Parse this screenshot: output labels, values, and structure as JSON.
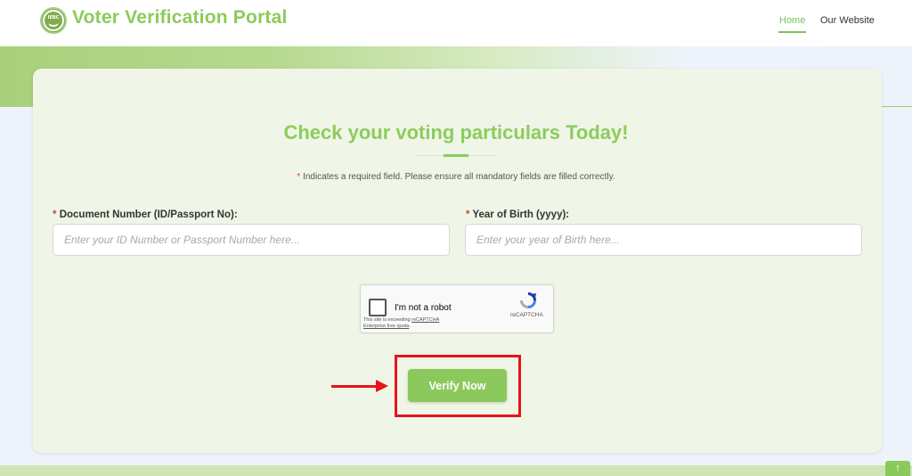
{
  "header": {
    "logo_icon": "emblem-icon",
    "title": "Voter Verification Portal",
    "nav": [
      {
        "label": "Home",
        "active": true
      },
      {
        "label": "Our Website",
        "active": false
      }
    ]
  },
  "form": {
    "title": "Check your voting particulars Today!",
    "required_mark": "*",
    "required_note": "Indicates a required field. Please ensure all mandatory fields are filled correctly.",
    "document_label": "Document Number (ID/Passport No):",
    "document_placeholder": "Enter your ID Number or Passport Number here...",
    "document_value": "",
    "year_label": "Year of Birth (yyyy):",
    "year_placeholder": "Enter your year of Birth here...",
    "year_value": ""
  },
  "captcha": {
    "checkbox_label": "I'm not a robot",
    "warning_prefix": "This site is exceeding ",
    "warning_link1": "reCAPTCHA",
    "warning_link2": "Enterprise free quota",
    "warning_suffix": ".",
    "brand": "reCAPTCHA",
    "checked": false
  },
  "submit": {
    "label": "Verify Now"
  },
  "scroll_top": {
    "icon": "arrow-up-icon",
    "glyph": "↑"
  },
  "colors": {
    "brand_green": "#8dcc5c",
    "highlight_red": "#e5141b",
    "required_red": "#e23a2e"
  }
}
